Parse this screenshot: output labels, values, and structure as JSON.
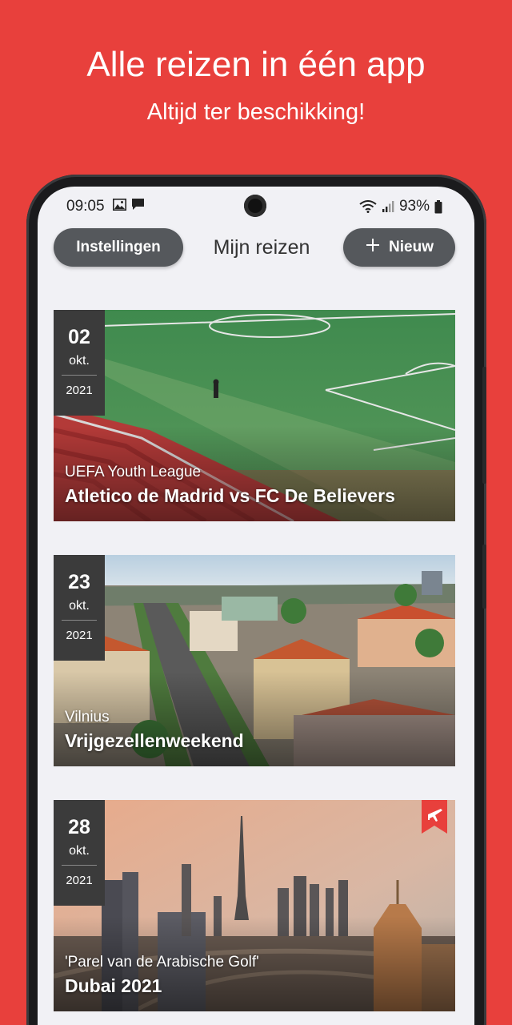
{
  "promo": {
    "title": "Alle reizen in één app",
    "subtitle": "Altijd ter beschikking!"
  },
  "status_bar": {
    "time": "09:05",
    "battery": "93%",
    "left_icons": [
      "image-icon",
      "message-icon"
    ],
    "right_icons": [
      "wifi-icon",
      "signal-icon",
      "battery-icon"
    ]
  },
  "header": {
    "settings_label": "Instellingen",
    "title": "Mijn reizen",
    "new_label": "Nieuw",
    "new_icon": "plus-icon"
  },
  "trips": [
    {
      "day": "02",
      "month": "okt.",
      "year": "2021",
      "subtitle": "UEFA Youth League",
      "title": "Atletico de Madrid vs FC De Believers"
    },
    {
      "day": "23",
      "month": "okt.",
      "year": "2021",
      "subtitle": "Vilnius",
      "title": "Vrijgezellenweekend"
    },
    {
      "day": "28",
      "month": "okt.",
      "year": "2021",
      "subtitle": "'Parel van de Arabische Golf'",
      "title": "Dubai 2021",
      "badge_icon": "airplane-icon"
    }
  ],
  "colors": {
    "background": "#e8403c",
    "button": "#55585c",
    "date_box": "#3b3b3b",
    "badge": "#e8403c"
  }
}
